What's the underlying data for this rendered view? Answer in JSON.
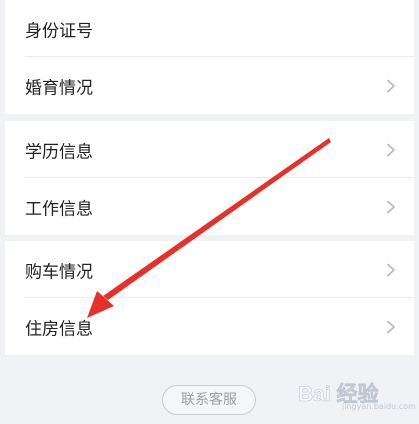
{
  "sections": [
    {
      "items": [
        {
          "label": "身份证号",
          "chevron": false
        },
        {
          "label": "婚育情况",
          "chevron": true
        }
      ]
    },
    {
      "items": [
        {
          "label": "学历信息",
          "chevron": true
        },
        {
          "label": "工作信息",
          "chevron": true
        }
      ]
    },
    {
      "items": [
        {
          "label": "购车情况",
          "chevron": true
        },
        {
          "label": "住房信息",
          "chevron": true
        }
      ]
    }
  ],
  "contact_button": {
    "label": "联系客服"
  },
  "annotation": {
    "color": "#e8302a",
    "icon": "red-arrow-icon"
  },
  "watermark": {
    "text": "Bai 经验",
    "sub": "jingyan.baidu.com"
  },
  "colors": {
    "background": "#f0f2f5",
    "card": "#ffffff",
    "text": "#222222",
    "chevron": "#b4b8bf"
  }
}
